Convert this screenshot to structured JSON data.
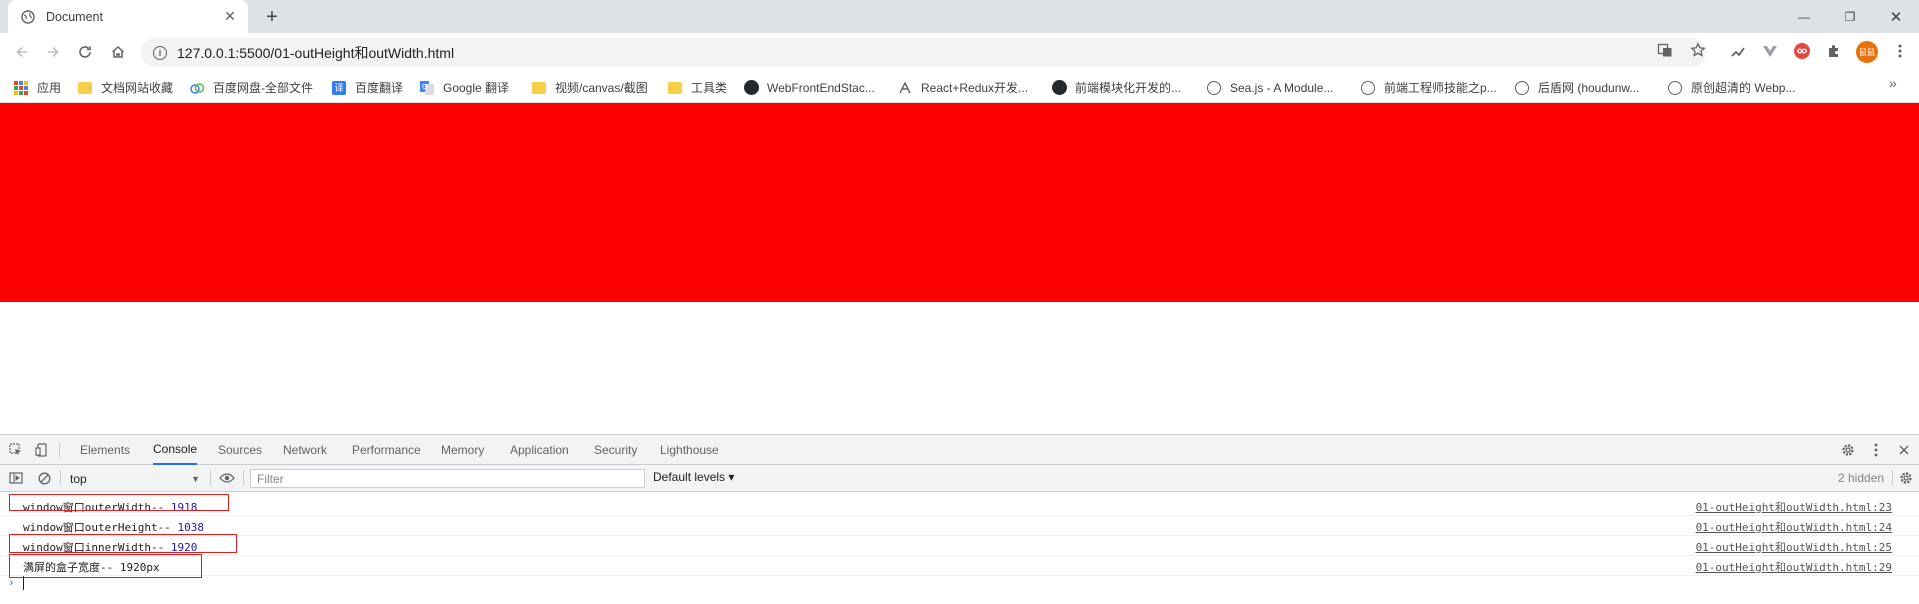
{
  "tab": {
    "title": "Document",
    "close": "✕"
  },
  "newtab": "+",
  "window_controls": {
    "minimize": "—",
    "restore": "❐",
    "close": "✕"
  },
  "omnibox": {
    "url": "127.0.0.1:5500/01-outHeight和outWidth.html",
    "info": "i"
  },
  "bookmarks": [
    {
      "label": "应用",
      "icon": "apps-icon"
    },
    {
      "label": "文档网站收藏",
      "icon": "folder-icon"
    },
    {
      "label": "百度网盘-全部文件",
      "icon": "baidu-cloud-icon"
    },
    {
      "label": "百度翻译",
      "icon": "baidu-translate-icon"
    },
    {
      "label": "Google 翻译",
      "icon": "google-translate-icon"
    },
    {
      "label": "视频/canvas/截图",
      "icon": "folder-icon"
    },
    {
      "label": "工具类",
      "icon": "folder-icon"
    },
    {
      "label": "WebFrontEndStac...",
      "icon": "github-icon"
    },
    {
      "label": "React+Redux开发...",
      "icon": "react-icon"
    },
    {
      "label": "前端模块化开发的...",
      "icon": "github-icon"
    },
    {
      "label": "Sea.js - A Module...",
      "icon": "globe-icon"
    },
    {
      "label": "前端工程师技能之p...",
      "icon": "globe-icon"
    },
    {
      "label": "后盾网 (houdunw...",
      "icon": "globe-icon"
    },
    {
      "label": "原创超清的 Webp...",
      "icon": "globe-icon"
    }
  ],
  "bookmarks_more": "»",
  "avatar_text": "鼠鼠",
  "devtools": {
    "tabs": [
      "Elements",
      "Console",
      "Sources",
      "Network",
      "Performance",
      "Memory",
      "Application",
      "Security",
      "Lighthouse"
    ],
    "active_tab": "Console",
    "context": "top",
    "filter_placeholder": "Filter",
    "levels": "Default levels ▾",
    "hidden": "2 hidden"
  },
  "console_logs": [
    {
      "text": "window窗口outerWidth-- ",
      "value": "1918",
      "source": "01-outHeight和outWidth.html:23"
    },
    {
      "text": "window窗口outerHeight-- ",
      "value": "1038",
      "source": "01-outHeight和outWidth.html:24"
    },
    {
      "text": "window窗口innerWidth-- ",
      "value": "1920",
      "source": "01-outHeight和outWidth.html:25"
    },
    {
      "text": "满屏的盒子宽度-- 1920px",
      "value": "",
      "source": "01-outHeight和outWidth.html:29"
    }
  ],
  "colors": {
    "page_box": "#ff0000",
    "highlight": "#e02020",
    "accent": "#1a73e8"
  }
}
